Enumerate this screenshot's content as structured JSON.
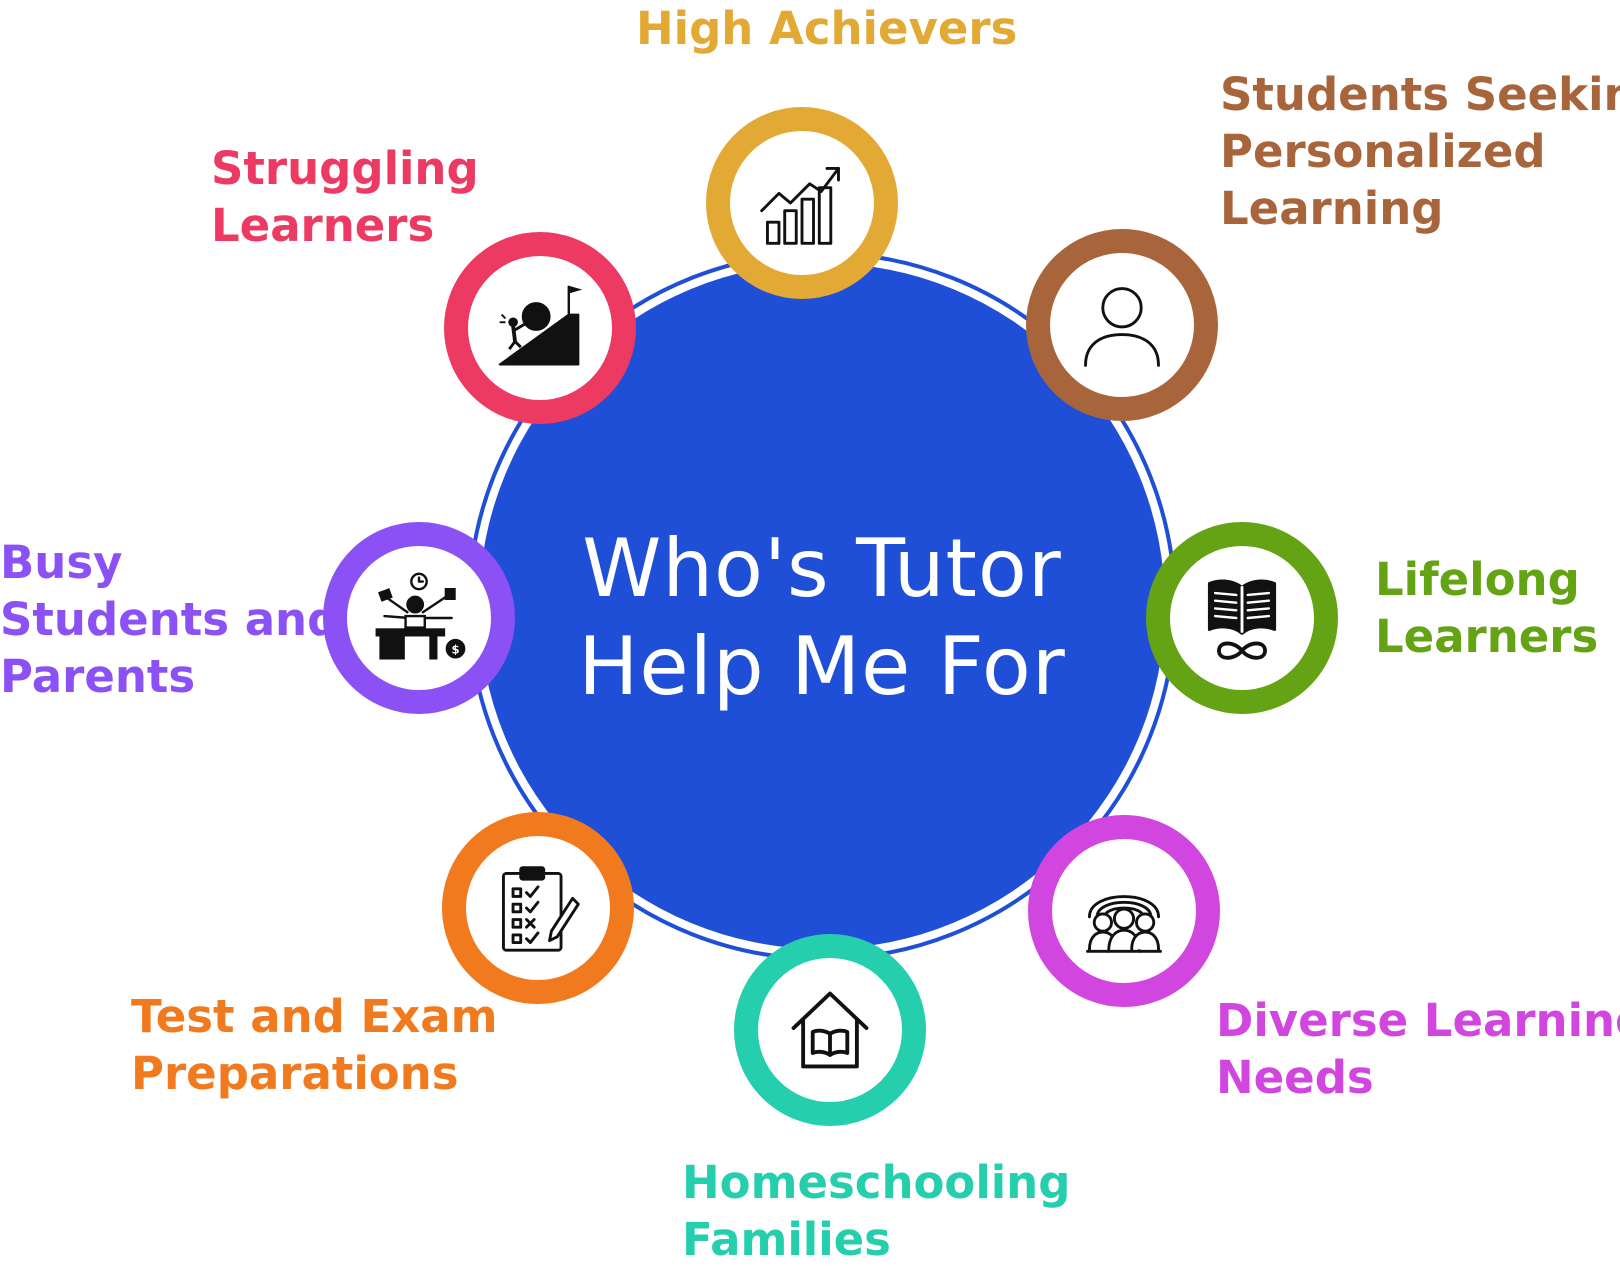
{
  "center": {
    "line1": "Who's Tutor",
    "line2": "Help Me For"
  },
  "center_color": "#1f4fd6",
  "items": [
    {
      "id": "high-achievers",
      "lines": [
        "High Achievers"
      ],
      "color": "#e2a935",
      "icon": "growth-chart-icon"
    },
    {
      "id": "personalized",
      "lines": [
        "Students Seeking",
        "Personalized",
        "Learning"
      ],
      "color": "#a8653b",
      "icon": "person-icon"
    },
    {
      "id": "lifelong",
      "lines": [
        "Lifelong",
        "Learners"
      ],
      "color": "#64a314",
      "icon": "infinity-book-icon"
    },
    {
      "id": "diverse",
      "lines": [
        "Diverse Learning",
        "Needs"
      ],
      "color": "#d246e0",
      "icon": "diverse-people-icon"
    },
    {
      "id": "homeschooling",
      "lines": [
        "Homeschooling",
        "Families"
      ],
      "color": "#25cfae",
      "icon": "home-book-icon"
    },
    {
      "id": "test-prep",
      "lines": [
        "Test and Exam",
        "Preparations"
      ],
      "color": "#f27a1e",
      "icon": "checklist-icon"
    },
    {
      "id": "busy",
      "lines": [
        "Busy",
        "Students and",
        "Parents"
      ],
      "color": "#8b51f5",
      "icon": "multitask-icon"
    },
    {
      "id": "struggling",
      "lines": [
        "Struggling",
        "Learners"
      ],
      "color": "#ec3a62",
      "icon": "uphill-struggle-icon"
    }
  ]
}
